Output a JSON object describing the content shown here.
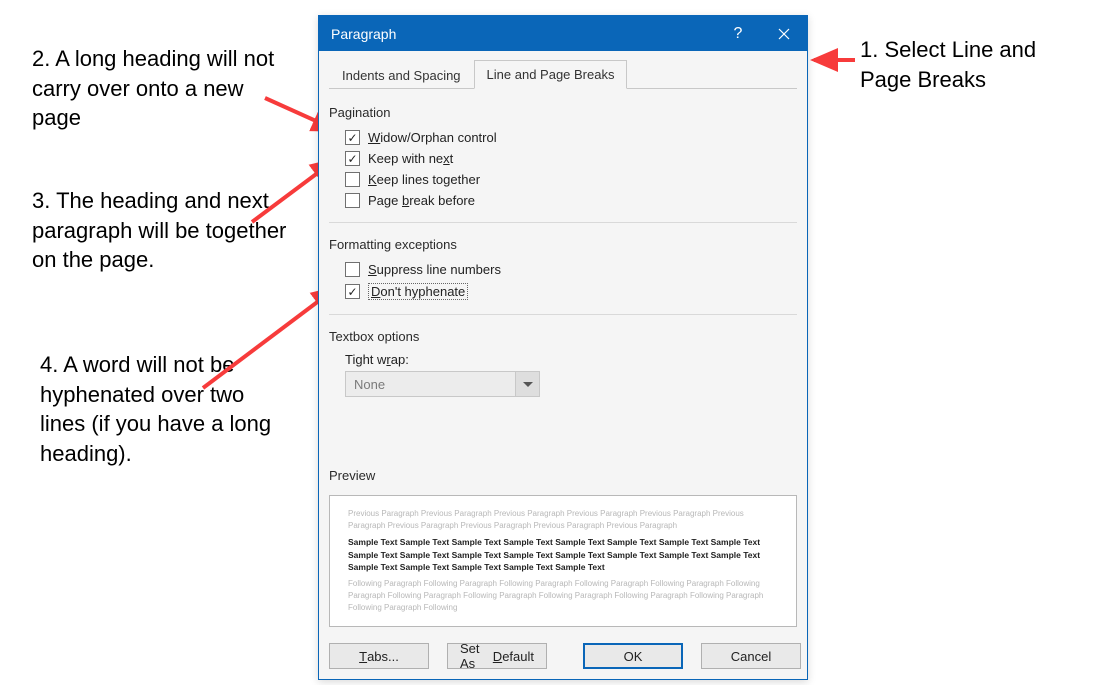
{
  "titlebar": {
    "title": "Paragraph"
  },
  "tabs": {
    "indents": "Indents and Spacing",
    "breaks": "Line and Page Breaks"
  },
  "sections": {
    "pagination": "Pagination",
    "formatting": "Formatting exceptions",
    "textbox": "Textbox options",
    "preview": "Preview"
  },
  "options": {
    "widow": "Widow/Orphan control",
    "keepnext": "Keep with next",
    "keeplines": "Keep lines together",
    "pagebreak": "Page break before",
    "suppress": "Suppress line numbers",
    "hyphenate": "Don't hyphenate"
  },
  "checked": {
    "widow": true,
    "keepnext": true,
    "keeplines": false,
    "pagebreak": false,
    "suppress": false,
    "hyphenate": true
  },
  "tightwrap": {
    "label": "Tight wrap:",
    "value": "None"
  },
  "preview": {
    "prev": "Previous Paragraph Previous Paragraph Previous Paragraph Previous Paragraph Previous Paragraph Previous Paragraph Previous Paragraph Previous Paragraph Previous Paragraph Previous Paragraph",
    "sample": "Sample Text Sample Text Sample Text Sample Text Sample Text Sample Text Sample Text Sample Text Sample Text Sample Text Sample Text Sample Text Sample Text Sample Text Sample Text Sample Text Sample Text Sample Text Sample Text Sample Text Sample Text",
    "next": "Following Paragraph Following Paragraph Following Paragraph Following Paragraph Following Paragraph Following Paragraph Following Paragraph Following Paragraph Following Paragraph Following Paragraph Following Paragraph Following Paragraph Following"
  },
  "buttons": {
    "tabs": "Tabs...",
    "default": "Set As Default",
    "ok": "OK",
    "cancel": "Cancel"
  },
  "annotations": {
    "a1": "1. Select Line and Page Breaks",
    "a2": "2. A long heading will not carry over onto a new page",
    "a3": "3. The heading and next paragraph will be together on the page.",
    "a4": "4. A word will not be hyphenated over two lines (if you have a long heading)."
  },
  "colors": {
    "accent": "#0a66b8",
    "arrow": "#f73b3b"
  }
}
